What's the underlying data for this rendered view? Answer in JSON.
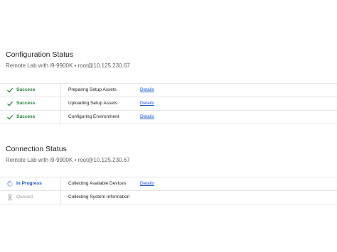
{
  "configuration": {
    "title": "Configuration Status",
    "subtitle": "Remote Lab with i9-9900K • root@10.125.230.67",
    "rows": [
      {
        "status": "Success",
        "step": "Preparing Setup Assets",
        "details": "Details",
        "icon": "check-icon"
      },
      {
        "status": "Success",
        "step": "Uploading Setup Assets",
        "details": "Details",
        "icon": "check-icon"
      },
      {
        "status": "Success",
        "step": "Configuring Environment",
        "details": "Details",
        "icon": "check-icon"
      }
    ]
  },
  "connection": {
    "title": "Connection Status",
    "subtitle": "Remote Lab with i9-9900K • root@10.125.230.67",
    "rows": [
      {
        "status": "In Progress",
        "step": "Collecting Available Devices",
        "details": "Details",
        "icon": "spinner-icon"
      },
      {
        "status": "Queued",
        "step": "Collecting System Information",
        "icon": "hourglass-icon"
      }
    ]
  },
  "colors": {
    "success": "#1e7e34",
    "in_progress": "#1a56c4",
    "queued": "#9aa0a6",
    "link": "#1a56c4",
    "divider": "#e6e6e6"
  }
}
